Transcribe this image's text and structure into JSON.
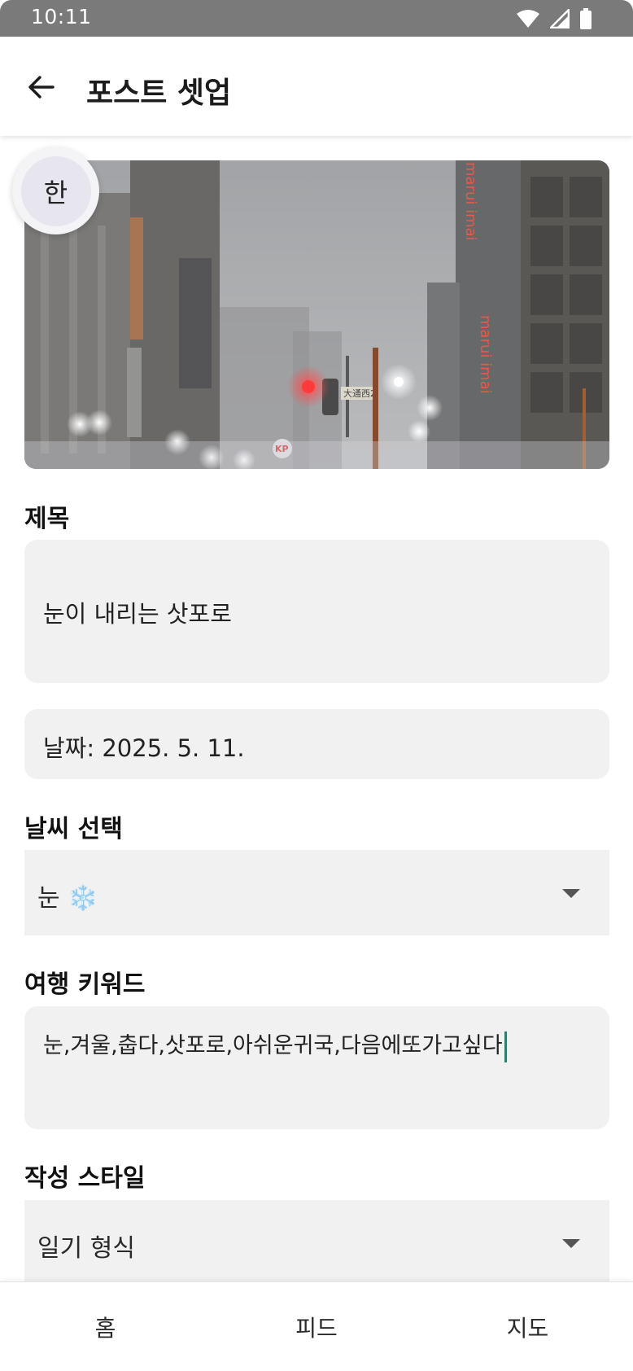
{
  "status_bar": {
    "time": "10:11"
  },
  "header": {
    "title": "포스트 셋업"
  },
  "language_badge": {
    "label": "한"
  },
  "form": {
    "title_label": "제목",
    "title_value": "눈이 내리는 삿포로",
    "date_text": "날짜: 2025. 5. 11.",
    "weather_label": "날씨 선택",
    "weather_value": "눈",
    "weather_emoji": "❄️",
    "keywords_label": "여행 키워드",
    "keywords_value": "눈,겨울,춥다,삿포로,아쉬운귀국,다음에또가고싶다",
    "style_label": "작성 스타일",
    "style_value": "일기 형식"
  },
  "photo_signs": {
    "store_sign": "marui imai",
    "store_sign_2": "marui imai",
    "street_sign": "大通西2",
    "small_sign": "KP"
  },
  "bottom_nav": {
    "items": [
      {
        "label": "홈"
      },
      {
        "label": "피드"
      },
      {
        "label": "지도"
      }
    ]
  },
  "colors": {
    "accent_caret": "#2e7d6d",
    "field_bg": "#f1f1f1"
  }
}
